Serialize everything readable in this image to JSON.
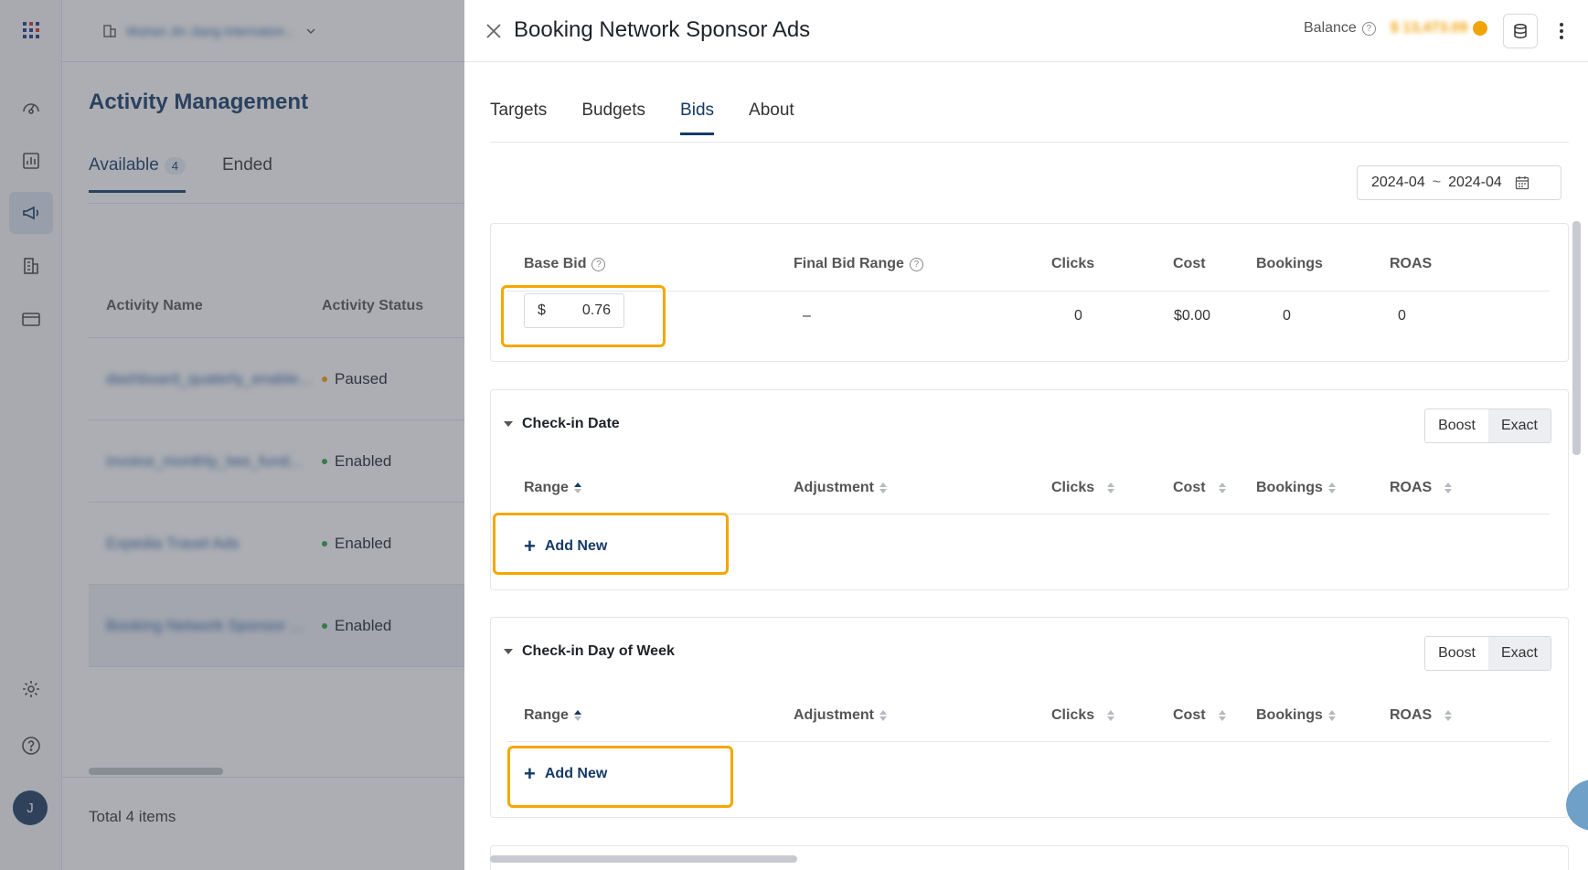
{
  "background_page": {
    "org_name": "Wuhan Jin Jiang Internation...",
    "title": "Activity Management",
    "tabs": [
      {
        "label": "Available",
        "count": "4"
      },
      {
        "label": "Ended"
      }
    ],
    "columns": [
      "Activity Name",
      "Activity Status"
    ],
    "rows": [
      {
        "name": "dashboard_quaterly_enable...",
        "status": "Paused",
        "status_color": "#f0a30a"
      },
      {
        "name": "invoice_monthly_two_fund...",
        "status": "Enabled",
        "status_color": "#2e9e44"
      },
      {
        "name": "Expedia Travel Ads",
        "status": "Enabled",
        "status_color": "#2e9e44"
      },
      {
        "name": "Booking Network Sponsor ...",
        "status": "Enabled",
        "status_color": "#2e9e44"
      }
    ],
    "total": "Total 4 items"
  },
  "drawer": {
    "title": "Booking Network Sponsor Ads",
    "balance_label": "Balance",
    "balance_value": "$ 13,473.09",
    "tabs": [
      "Targets",
      "Budgets",
      "Bids",
      "About"
    ],
    "active_tab": "Bids",
    "date_from": "2024-04",
    "date_sep": "~",
    "date_to": "2024-04",
    "base_bid": {
      "headers": {
        "base_bid": "Base Bid",
        "final_bid_range": "Final Bid Range",
        "clicks": "Clicks",
        "cost": "Cost",
        "bookings": "Bookings",
        "roas": "ROAS"
      },
      "currency": "$",
      "value": "0.76",
      "final_bid_range": "–",
      "clicks": "0",
      "cost": "$0.00",
      "bookings": "0",
      "roas": "0"
    },
    "sections": [
      {
        "title": "Check-in Date",
        "toggle": [
          "Boost",
          "Exact"
        ],
        "headers": [
          "Range",
          "Adjustment",
          "Clicks",
          "Cost",
          "Bookings",
          "ROAS"
        ],
        "add_label": "Add New"
      },
      {
        "title": "Check-in Day of Week",
        "toggle": [
          "Boost",
          "Exact"
        ],
        "headers": [
          "Range",
          "Adjustment",
          "Clicks",
          "Cost",
          "Bookings",
          "ROAS"
        ],
        "add_label": "Add New"
      }
    ],
    "highlight_color": "#f5a700"
  },
  "rail": {
    "avatar_initial": "J",
    "icons": [
      "apps-grid-icon",
      "dashboard-icon",
      "report-chart-icon",
      "megaphone-icon",
      "building-icon",
      "billing-card-icon",
      "settings-gear-icon",
      "help-circle-icon"
    ]
  }
}
